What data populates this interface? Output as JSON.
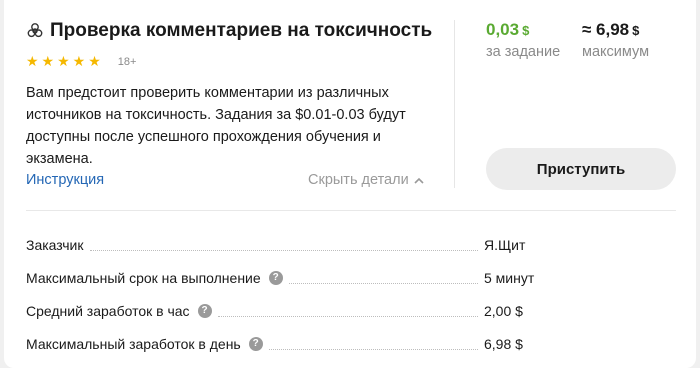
{
  "task": {
    "title": "Проверка комментариев на токсичность",
    "title_icon": "biohazard-icon",
    "stars": "★★★★★",
    "age_rating": "18+",
    "description": "Вам предстоит проверить комментарии из различных источников на токсичность. Задания за $0.01-0.03 будут доступны после успешного прохождения обучения и экзамена.",
    "instruction_link": "Инструкция",
    "hide_details": "Скрыть детали"
  },
  "pricing": {
    "price_value": "0,03",
    "price_currency": "$",
    "price_label": "за задание",
    "max_value": "≈ 6,98",
    "max_currency": "$",
    "max_label": "максимум"
  },
  "actions": {
    "start_label": "Приступить"
  },
  "details": [
    {
      "label": "Заказчик",
      "value": "Я.Щит",
      "has_help": false
    },
    {
      "label": "Максимальный срок на выполнение",
      "value": "5 минут",
      "has_help": true
    },
    {
      "label": "Средний заработок в час",
      "value": "2,00 $",
      "has_help": true
    },
    {
      "label": "Максимальный заработок в день",
      "value": "6,98 $",
      "has_help": true
    }
  ],
  "colors": {
    "price_green": "#5aaa32",
    "link_blue": "#2467b5",
    "star_yellow": "#f5b800"
  }
}
